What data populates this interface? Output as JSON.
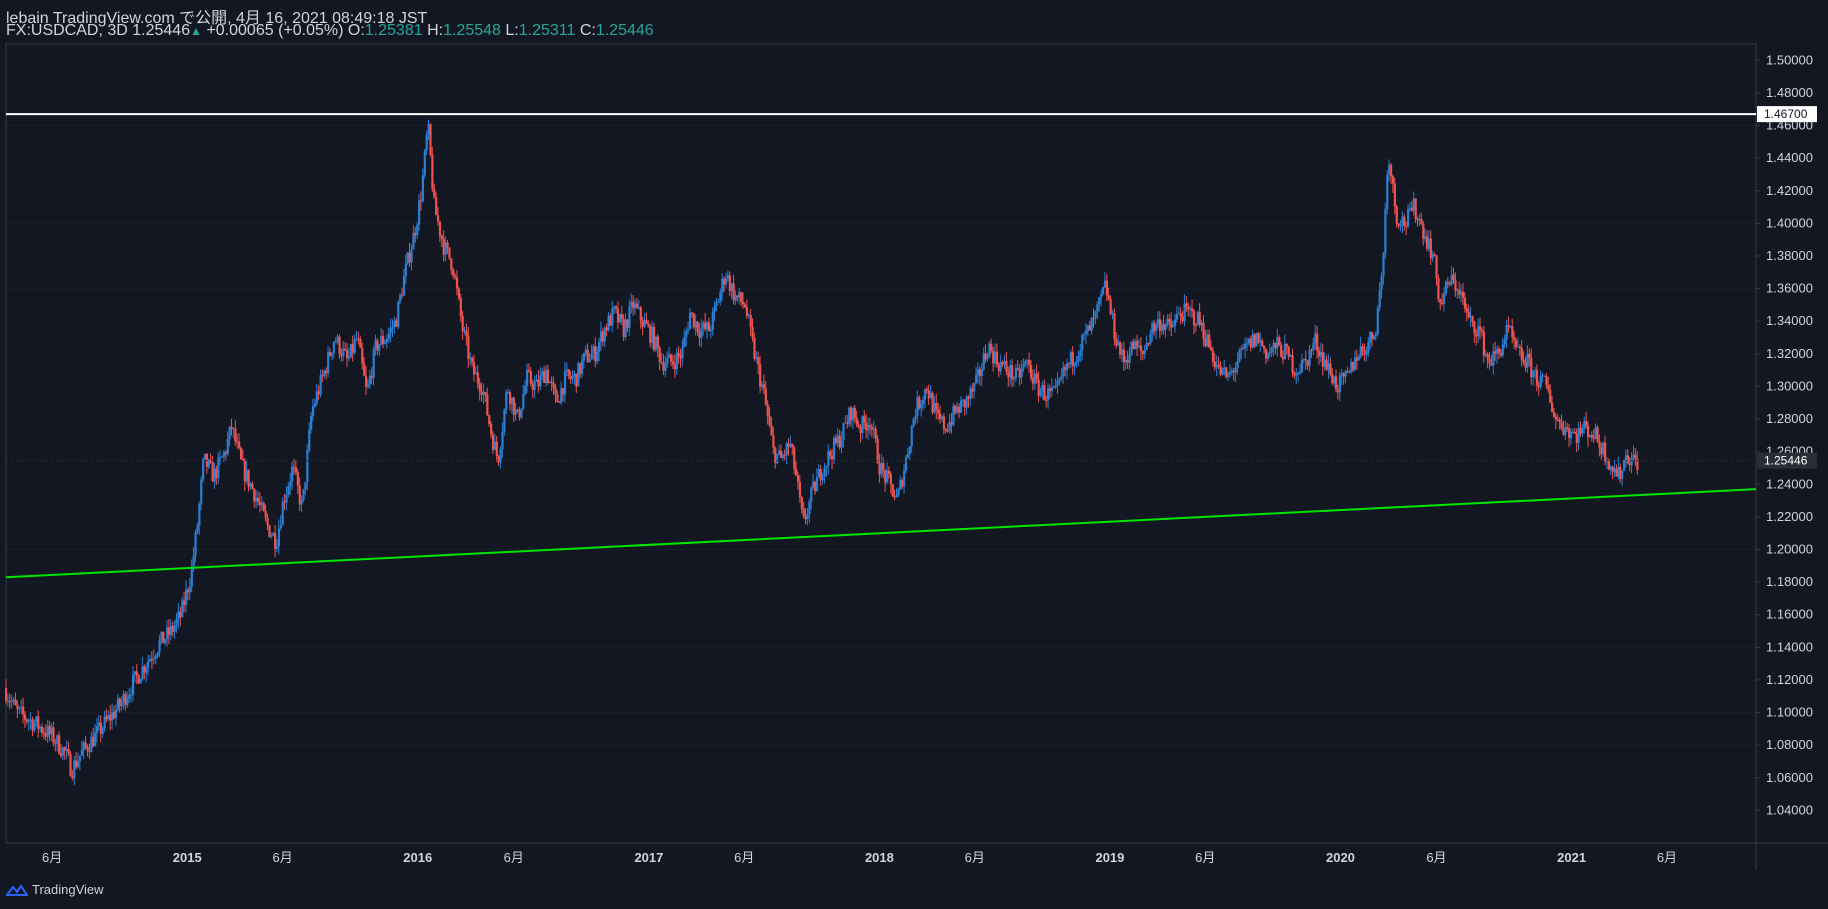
{
  "header": {
    "title": "lebain TradingView.com で公開, 4月 16, 2021 08:49:18 JST",
    "symbol": "FX:USDCAD, 3D",
    "last": "1.25446",
    "change_arrow": "▲",
    "change": "+0.00065 (+0.05%)",
    "o_label": "O:",
    "o_value": "1.25381",
    "h_label": "H:",
    "h_value": "1.25548",
    "l_label": "L:",
    "l_value": "1.25311",
    "c_label": "C:",
    "c_value": "1.25446"
  },
  "footer": {
    "brand": "TradingView"
  },
  "colors": {
    "background": "#131722",
    "up": "#2a7fd4",
    "down": "#ef5350",
    "support_line": "#00e600",
    "resistance_line": "#ffffff",
    "text": "#d1d4dc"
  },
  "chart_data": {
    "type": "candlestick",
    "symbol": "FX:USDCAD",
    "timeframe": "3D",
    "x_range": [
      "2014-03-20",
      "2021-10-20"
    ],
    "ylim": [
      1.02,
      1.51
    ],
    "y_ticks": [
      "1.04000",
      "1.06000",
      "1.08000",
      "1.10000",
      "1.12000",
      "1.14000",
      "1.16000",
      "1.18000",
      "1.20000",
      "1.22000",
      "1.24000",
      "1.26000",
      "1.28000",
      "1.30000",
      "1.32000",
      "1.34000",
      "1.36000",
      "1.38000",
      "1.40000",
      "1.42000",
      "1.44000",
      "1.46000",
      "1.48000",
      "1.50000"
    ],
    "x_ticks": [
      {
        "date": "2014-06-01",
        "label": "6月",
        "year": false
      },
      {
        "date": "2015-01-01",
        "label": "2015",
        "year": true
      },
      {
        "date": "2015-06-01",
        "label": "6月",
        "year": false
      },
      {
        "date": "2016-01-01",
        "label": "2016",
        "year": true
      },
      {
        "date": "2016-06-01",
        "label": "6月",
        "year": false
      },
      {
        "date": "2017-01-01",
        "label": "2017",
        "year": true
      },
      {
        "date": "2017-06-01",
        "label": "6月",
        "year": false
      },
      {
        "date": "2018-01-01",
        "label": "2018",
        "year": true
      },
      {
        "date": "2018-06-01",
        "label": "6月",
        "year": false
      },
      {
        "date": "2019-01-01",
        "label": "2019",
        "year": true
      },
      {
        "date": "2019-06-01",
        "label": "6月",
        "year": false
      },
      {
        "date": "2020-01-01",
        "label": "2020",
        "year": true
      },
      {
        "date": "2020-06-01",
        "label": "6月",
        "year": false
      },
      {
        "date": "2021-01-01",
        "label": "2021",
        "year": true
      },
      {
        "date": "2021-06-01",
        "label": "6月",
        "year": false
      }
    ],
    "price_path": [
      [
        "2014-03-20",
        1.115
      ],
      [
        "2014-04-10",
        1.1
      ],
      [
        "2014-05-01",
        1.095
      ],
      [
        "2014-05-20",
        1.09
      ],
      [
        "2014-06-05",
        1.085
      ],
      [
        "2014-06-25",
        1.075
      ],
      [
        "2014-07-05",
        1.065
      ],
      [
        "2014-07-20",
        1.075
      ],
      [
        "2014-08-10",
        1.085
      ],
      [
        "2014-08-30",
        1.095
      ],
      [
        "2014-09-20",
        1.105
      ],
      [
        "2014-10-10",
        1.118
      ],
      [
        "2014-10-30",
        1.13
      ],
      [
        "2014-11-20",
        1.142
      ],
      [
        "2014-12-10",
        1.15
      ],
      [
        "2014-12-25",
        1.16
      ],
      [
        "2015-01-10",
        1.185
      ],
      [
        "2015-01-20",
        1.215
      ],
      [
        "2015-01-30",
        1.255
      ],
      [
        "2015-02-15",
        1.245
      ],
      [
        "2015-03-05",
        1.26
      ],
      [
        "2015-03-15",
        1.275
      ],
      [
        "2015-04-01",
        1.25
      ],
      [
        "2015-04-20",
        1.235
      ],
      [
        "2015-05-10",
        1.215
      ],
      [
        "2015-05-25",
        1.205
      ],
      [
        "2015-06-05",
        1.23
      ],
      [
        "2015-06-20",
        1.25
      ],
      [
        "2015-07-05",
        1.225
      ],
      [
        "2015-07-20",
        1.285
      ],
      [
        "2015-08-10",
        1.31
      ],
      [
        "2015-08-25",
        1.33
      ],
      [
        "2015-09-15",
        1.315
      ],
      [
        "2015-09-30",
        1.33
      ],
      [
        "2015-10-15",
        1.295
      ],
      [
        "2015-10-30",
        1.325
      ],
      [
        "2015-11-15",
        1.33
      ],
      [
        "2015-11-30",
        1.34
      ],
      [
        "2015-12-15",
        1.37
      ],
      [
        "2015-12-30",
        1.395
      ],
      [
        "2016-01-10",
        1.42
      ],
      [
        "2016-01-20",
        1.46
      ],
      [
        "2016-01-30",
        1.41
      ],
      [
        "2016-02-15",
        1.385
      ],
      [
        "2016-02-28",
        1.375
      ],
      [
        "2016-03-15",
        1.335
      ],
      [
        "2016-03-30",
        1.31
      ],
      [
        "2016-04-15",
        1.3
      ],
      [
        "2016-04-30",
        1.27
      ],
      [
        "2016-05-10",
        1.255
      ],
      [
        "2016-05-25",
        1.3
      ],
      [
        "2016-06-10",
        1.28
      ],
      [
        "2016-06-25",
        1.305
      ],
      [
        "2016-07-10",
        1.3
      ],
      [
        "2016-07-25",
        1.31
      ],
      [
        "2016-08-10",
        1.29
      ],
      [
        "2016-08-25",
        1.305
      ],
      [
        "2016-09-10",
        1.305
      ],
      [
        "2016-09-25",
        1.318
      ],
      [
        "2016-10-10",
        1.32
      ],
      [
        "2016-10-25",
        1.335
      ],
      [
        "2016-11-10",
        1.345
      ],
      [
        "2016-11-25",
        1.335
      ],
      [
        "2016-12-10",
        1.35
      ],
      [
        "2016-12-25",
        1.34
      ],
      [
        "2017-01-10",
        1.33
      ],
      [
        "2017-01-25",
        1.315
      ],
      [
        "2017-02-10",
        1.315
      ],
      [
        "2017-02-25",
        1.32
      ],
      [
        "2017-03-10",
        1.345
      ],
      [
        "2017-03-25",
        1.335
      ],
      [
        "2017-04-10",
        1.335
      ],
      [
        "2017-04-25",
        1.355
      ],
      [
        "2017-05-05",
        1.37
      ],
      [
        "2017-05-20",
        1.355
      ],
      [
        "2017-06-05",
        1.35
      ],
      [
        "2017-06-20",
        1.32
      ],
      [
        "2017-07-05",
        1.295
      ],
      [
        "2017-07-20",
        1.26
      ],
      [
        "2017-08-01",
        1.255
      ],
      [
        "2017-08-15",
        1.265
      ],
      [
        "2017-08-25",
        1.245
      ],
      [
        "2017-09-05",
        1.215
      ],
      [
        "2017-09-20",
        1.235
      ],
      [
        "2017-10-05",
        1.25
      ],
      [
        "2017-10-20",
        1.26
      ],
      [
        "2017-11-05",
        1.27
      ],
      [
        "2017-11-20",
        1.285
      ],
      [
        "2017-12-05",
        1.275
      ],
      [
        "2017-12-20",
        1.28
      ],
      [
        "2018-01-05",
        1.25
      ],
      [
        "2018-01-20",
        1.24
      ],
      [
        "2018-02-01",
        1.23
      ],
      [
        "2018-02-15",
        1.255
      ],
      [
        "2018-03-01",
        1.285
      ],
      [
        "2018-03-20",
        1.3
      ],
      [
        "2018-04-05",
        1.28
      ],
      [
        "2018-04-20",
        1.275
      ],
      [
        "2018-05-05",
        1.285
      ],
      [
        "2018-05-20",
        1.29
      ],
      [
        "2018-06-05",
        1.3
      ],
      [
        "2018-06-25",
        1.325
      ],
      [
        "2018-07-10",
        1.315
      ],
      [
        "2018-07-25",
        1.31
      ],
      [
        "2018-08-10",
        1.305
      ],
      [
        "2018-08-25",
        1.315
      ],
      [
        "2018-09-10",
        1.3
      ],
      [
        "2018-09-25",
        1.295
      ],
      [
        "2018-10-10",
        1.295
      ],
      [
        "2018-10-25",
        1.31
      ],
      [
        "2018-11-10",
        1.32
      ],
      [
        "2018-11-25",
        1.33
      ],
      [
        "2018-12-10",
        1.34
      ],
      [
        "2018-12-28",
        1.362
      ],
      [
        "2019-01-10",
        1.335
      ],
      [
        "2019-01-25",
        1.315
      ],
      [
        "2019-02-10",
        1.325
      ],
      [
        "2019-02-25",
        1.32
      ],
      [
        "2019-03-10",
        1.335
      ],
      [
        "2019-03-25",
        1.34
      ],
      [
        "2019-04-10",
        1.335
      ],
      [
        "2019-04-25",
        1.345
      ],
      [
        "2019-05-10",
        1.345
      ],
      [
        "2019-05-25",
        1.34
      ],
      [
        "2019-06-10",
        1.325
      ],
      [
        "2019-06-25",
        1.31
      ],
      [
        "2019-07-10",
        1.305
      ],
      [
        "2019-07-25",
        1.315
      ],
      [
        "2019-08-10",
        1.325
      ],
      [
        "2019-08-25",
        1.33
      ],
      [
        "2019-09-10",
        1.32
      ],
      [
        "2019-09-25",
        1.325
      ],
      [
        "2019-10-10",
        1.32
      ],
      [
        "2019-10-25",
        1.31
      ],
      [
        "2019-11-10",
        1.315
      ],
      [
        "2019-11-25",
        1.328
      ],
      [
        "2019-12-10",
        1.315
      ],
      [
        "2019-12-30",
        1.3
      ],
      [
        "2020-01-15",
        1.305
      ],
      [
        "2020-01-30",
        1.32
      ],
      [
        "2020-02-15",
        1.325
      ],
      [
        "2020-02-28",
        1.335
      ],
      [
        "2020-03-10",
        1.37
      ],
      [
        "2020-03-20",
        1.445
      ],
      [
        "2020-04-01",
        1.405
      ],
      [
        "2020-04-15",
        1.4
      ],
      [
        "2020-04-30",
        1.41
      ],
      [
        "2020-05-15",
        1.395
      ],
      [
        "2020-05-30",
        1.38
      ],
      [
        "2020-06-10",
        1.35
      ],
      [
        "2020-06-25",
        1.365
      ],
      [
        "2020-07-10",
        1.36
      ],
      [
        "2020-07-25",
        1.34
      ],
      [
        "2020-08-10",
        1.335
      ],
      [
        "2020-08-25",
        1.315
      ],
      [
        "2020-09-10",
        1.32
      ],
      [
        "2020-09-25",
        1.335
      ],
      [
        "2020-10-10",
        1.32
      ],
      [
        "2020-10-25",
        1.315
      ],
      [
        "2020-11-10",
        1.305
      ],
      [
        "2020-11-25",
        1.3
      ],
      [
        "2020-12-10",
        1.28
      ],
      [
        "2020-12-25",
        1.275
      ],
      [
        "2021-01-10",
        1.27
      ],
      [
        "2021-01-25",
        1.275
      ],
      [
        "2021-02-10",
        1.27
      ],
      [
        "2021-02-25",
        1.26
      ],
      [
        "2021-03-10",
        1.25
      ],
      [
        "2021-03-20",
        1.245
      ],
      [
        "2021-04-01",
        1.258
      ],
      [
        "2021-04-15",
        1.254
      ]
    ],
    "horizontal_line": {
      "value": 1.467,
      "label": "1.46700"
    },
    "trend_line": {
      "start": [
        "2014-03-20",
        1.183
      ],
      "end": [
        "2021-10-20",
        1.237
      ]
    },
    "last_price": {
      "value": 1.25446,
      "label": "1.25446"
    }
  }
}
